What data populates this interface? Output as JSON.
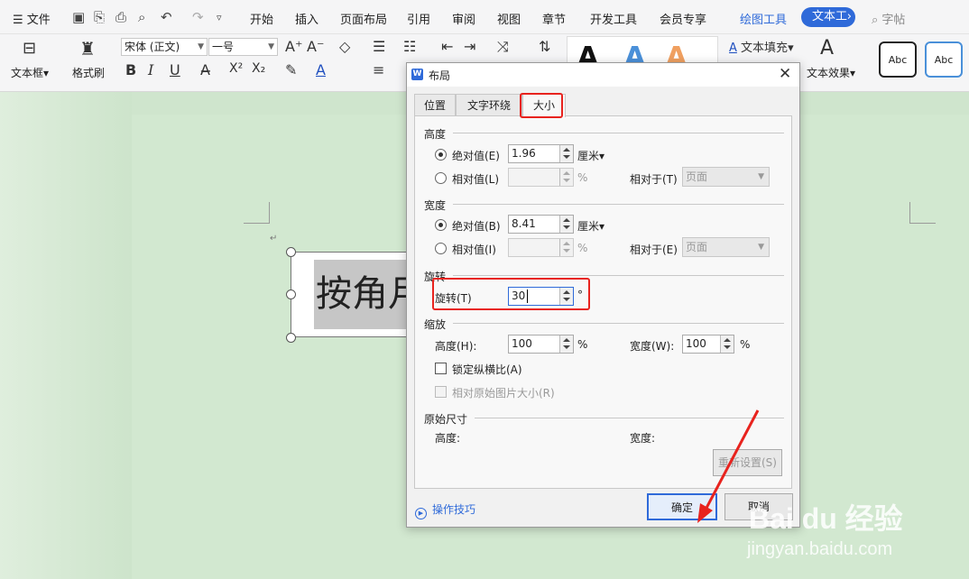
{
  "menu": {
    "file": "文件",
    "tabs": [
      "开始",
      "插入",
      "页面布局",
      "引用",
      "审阅",
      "视图",
      "章节",
      "开发工具",
      "会员专享"
    ],
    "draw_tools": "绘图工具",
    "text_tools": "文本工",
    "search": "字帖"
  },
  "ribbon": {
    "textbox_label": "文本框",
    "format_painter": "格式刷",
    "font_name": "宋体 (正文)",
    "font_size": "一号",
    "text_fill": "文本填充",
    "text_effect": "文本效果",
    "abc1": "Abc",
    "abc2": "Abc",
    "bold": "B",
    "italic": "I",
    "underline": "U",
    "sup": "X²",
    "sub": "X₂"
  },
  "document": {
    "text": "按角月"
  },
  "dialog": {
    "title": "布局",
    "tabs": [
      "位置",
      "文字环绕",
      "大小"
    ],
    "height": {
      "section": "高度",
      "absolute_label": "绝对值(E)",
      "absolute_value": "1.96",
      "unit": "厘米",
      "relative_label": "相对值(L)",
      "percent": "%",
      "relative_to_label": "相对于(T)",
      "relative_to_value": "页面"
    },
    "width": {
      "section": "宽度",
      "absolute_label": "绝对值(B)",
      "absolute_value": "8.41",
      "unit": "厘米",
      "relative_label": "相对值(I)",
      "percent": "%",
      "relative_to_label": "相对于(E)",
      "relative_to_value": "页面"
    },
    "rotation": {
      "section": "旋转",
      "label": "旋转(T)",
      "value": "30",
      "unit": "°"
    },
    "scale": {
      "section": "缩放",
      "height_label": "高度(H):",
      "height_value": "100",
      "width_label": "宽度(W):",
      "width_value": "100",
      "percent": "%",
      "lock_aspect": "锁定纵横比(A)",
      "relative_original": "相对原始图片大小(R)"
    },
    "original": {
      "section": "原始尺寸",
      "height_label": "高度:",
      "width_label": "宽度:",
      "reset": "重新设置(S)"
    },
    "tips": "操作技巧",
    "ok": "确定",
    "cancel": "取消"
  },
  "watermark": {
    "brand": "Bai du 经验",
    "url": "jingyan.baidu.com"
  },
  "colors": {
    "accent": "#2f6ad9",
    "highlight": "#e8231e",
    "background": "#cfe5cd"
  }
}
